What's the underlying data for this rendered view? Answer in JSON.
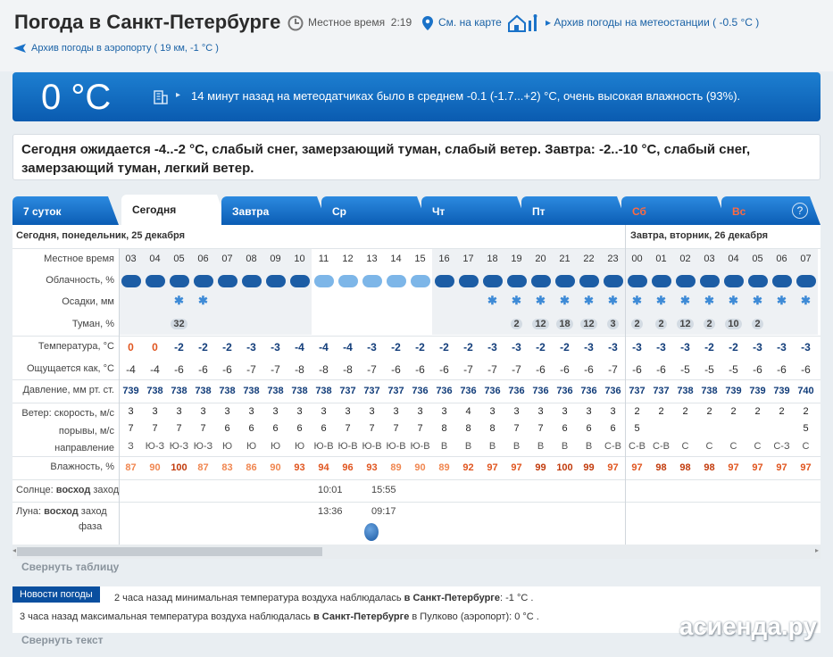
{
  "header": {
    "title": "Погода в Санкт-Петербурге",
    "local_time_label": "Местное время",
    "local_time": "2:19",
    "map_link": "См. на карте",
    "station_archive": "Архив погоды на метеостанции ( -0.5 °С )",
    "airport_archive": "Архив погоды в аэропорту ( 19 км, -1 °С )"
  },
  "current": {
    "temperature": "0 °C",
    "description": "14 минут назад на метеодатчиках было в среднем -0.1 (-1.7...+2) °C, очень высокая влажность (93%)."
  },
  "forecast_text": "Сегодня ожидается -4..-2 °C, слабый снег, замерзающий туман, слабый ветер. Завтра: -2..-10 °C, слабый снег, замерзающий туман, легкий ветер.",
  "tabs": [
    {
      "label": "7 суток",
      "active": false,
      "weekend": false
    },
    {
      "label": "Сегодня",
      "active": true,
      "weekend": false
    },
    {
      "label": "Завтра",
      "active": false,
      "weekend": false
    },
    {
      "label": "Ср",
      "active": false,
      "weekend": false
    },
    {
      "label": "Чт",
      "active": false,
      "weekend": false
    },
    {
      "label": "Пт",
      "active": false,
      "weekend": false
    },
    {
      "label": "Сб",
      "active": false,
      "weekend": true
    },
    {
      "label": "Вс",
      "active": false,
      "weekend": true
    }
  ],
  "help_label": "?",
  "day_today": "Сегодня, понедельник, 25 декабря",
  "day_tomorrow": "Завтра, вторник, 26 декабря",
  "row_labels": {
    "hour": "Местное время",
    "cloud": "Облачность, %",
    "precip": "Осадки, мм",
    "fog": "Туман, %",
    "temp": "Температура, °С",
    "feels": "Ощущается как, °С",
    "pressure": "Давление, мм рт. ст.",
    "wind_speed": "Ветер: скорость, м/с",
    "gusts": "порывы, м/с",
    "direction": "направление",
    "humidity": "Влажность, %",
    "sun_a": "Солнце:",
    "sun_b": "восход",
    "sun_c": "заход",
    "moon_a": "Луна:",
    "moon_b": "восход",
    "moon_c": "заход",
    "moon_phase": "фаза"
  },
  "hours": [
    "03",
    "04",
    "05",
    "06",
    "07",
    "08",
    "09",
    "10",
    "11",
    "12",
    "13",
    "14",
    "15",
    "16",
    "17",
    "18",
    "19",
    "20",
    "21",
    "22",
    "23",
    "00",
    "01",
    "02",
    "03",
    "04",
    "05",
    "06",
    "07"
  ],
  "clouds": [
    "d",
    "d",
    "d",
    "d",
    "d",
    "d",
    "d",
    "d",
    "l",
    "l",
    "l",
    "l",
    "l",
    "d",
    "d",
    "d",
    "d",
    "d",
    "d",
    "d",
    "d",
    "d",
    "d",
    "d",
    "d",
    "d",
    "d",
    "d",
    "d"
  ],
  "precip": [
    "",
    "",
    "*",
    "*",
    "",
    "",
    "",
    "",
    "",
    "",
    "",
    "",
    "",
    "",
    "",
    "*",
    "*",
    "*",
    "*",
    "*",
    "*",
    "*",
    "*",
    "*",
    "*",
    "*",
    "*",
    "*",
    "*"
  ],
  "fog": [
    "",
    "",
    "32",
    "",
    "",
    "",
    "",
    "",
    "",
    "",
    "",
    "",
    "",
    "",
    "",
    "",
    "2",
    "12",
    "18",
    "12",
    "3",
    "2",
    "2",
    "12",
    "2",
    "10",
    "2",
    "",
    ""
  ],
  "temperature": [
    "0",
    "0",
    "-2",
    "-2",
    "-2",
    "-3",
    "-3",
    "-4",
    "-4",
    "-4",
    "-3",
    "-2",
    "-2",
    "-2",
    "-2",
    "-3",
    "-3",
    "-2",
    "-2",
    "-3",
    "-3",
    "-3",
    "-3",
    "-3",
    "-2",
    "-2",
    "-3",
    "-3",
    "-3"
  ],
  "feels_like": [
    "-4",
    "-4",
    "-6",
    "-6",
    "-6",
    "-7",
    "-7",
    "-8",
    "-8",
    "-8",
    "-7",
    "-6",
    "-6",
    "-6",
    "-7",
    "-7",
    "-7",
    "-6",
    "-6",
    "-6",
    "-7",
    "-6",
    "-6",
    "-5",
    "-5",
    "-5",
    "-6",
    "-6",
    "-6"
  ],
  "pressure": [
    "739",
    "738",
    "738",
    "738",
    "738",
    "738",
    "738",
    "738",
    "738",
    "737",
    "737",
    "737",
    "736",
    "736",
    "736",
    "736",
    "736",
    "736",
    "736",
    "736",
    "736",
    "737",
    "737",
    "738",
    "738",
    "739",
    "739",
    "739",
    "740"
  ],
  "wind_speed": [
    "3",
    "3",
    "3",
    "3",
    "3",
    "3",
    "3",
    "3",
    "3",
    "3",
    "3",
    "3",
    "3",
    "3",
    "4",
    "3",
    "3",
    "3",
    "3",
    "3",
    "3",
    "2",
    "2",
    "2",
    "2",
    "2",
    "2",
    "2",
    "2"
  ],
  "gusts": [
    "7",
    "7",
    "7",
    "7",
    "6",
    "6",
    "6",
    "6",
    "6",
    "7",
    "7",
    "7",
    "7",
    "8",
    "8",
    "8",
    "7",
    "7",
    "6",
    "6",
    "6",
    "5",
    "",
    "",
    "",
    "",
    "",
    "",
    "5"
  ],
  "direction": [
    "З",
    "Ю-З",
    "Ю-З",
    "Ю-З",
    "Ю",
    "Ю",
    "Ю",
    "Ю",
    "Ю-В",
    "Ю-В",
    "Ю-В",
    "Ю-В",
    "Ю-В",
    "В",
    "В",
    "В",
    "В",
    "В",
    "В",
    "В",
    "С-В",
    "С-В",
    "С-В",
    "С",
    "С",
    "С",
    "С",
    "С-З",
    "С"
  ],
  "humidity": [
    "87",
    "90",
    "100",
    "87",
    "83",
    "86",
    "90",
    "93",
    "94",
    "96",
    "93",
    "89",
    "90",
    "89",
    "92",
    "97",
    "97",
    "99",
    "100",
    "99",
    "97",
    "97",
    "98",
    "98",
    "98",
    "97",
    "97",
    "97",
    "97"
  ],
  "sun": {
    "rise": "10:01",
    "set": "15:55"
  },
  "moon": {
    "rise": "13:36",
    "set": "09:17"
  },
  "collapse_table": "Свернуть таблицу",
  "news": {
    "badge": "Новости погоды",
    "line1_prefix": "2 часа назад минимальная температура воздуха наблюдалась",
    "line1_city": "в Санкт-Петербурге",
    "line1_value": ": -1 °C .",
    "line2_prefix": "3 часа назад максимальная температура воздуха наблюдалась",
    "line2_city": "в Санкт-Петербурге",
    "line2_value": "в Пулково (аэропорт): 0 °C ."
  },
  "collapse_text": "Свернуть текст",
  "watermark": "асиенда.ру"
}
